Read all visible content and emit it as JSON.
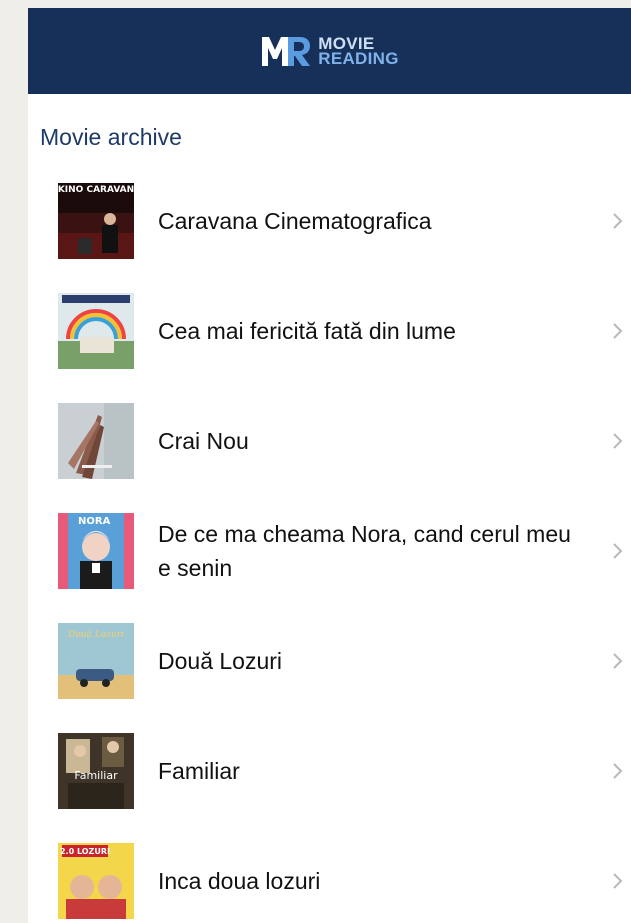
{
  "header": {
    "logo_line1": "MOVIE",
    "logo_line2": "READING",
    "background": "#17305a"
  },
  "section": {
    "title": "Movie archive"
  },
  "movies": [
    {
      "title": "Caravana Cinematografica",
      "poster_text": "KINO CARAVAN"
    },
    {
      "title": "Cea mai fericită fată din lume"
    },
    {
      "title": "Crai Nou"
    },
    {
      "title": "De ce ma cheama Nora, cand cerul meu e senin",
      "poster_text": "NORA"
    },
    {
      "title": "Două Lozuri",
      "poster_text": "Două Lozuri"
    },
    {
      "title": "Familiar",
      "poster_text": "Familiar"
    },
    {
      "title": "Inca doua lozuri",
      "poster_text": "2.0 LOZURI"
    }
  ],
  "icons": {
    "row_chevron": "chevron-right-icon"
  }
}
